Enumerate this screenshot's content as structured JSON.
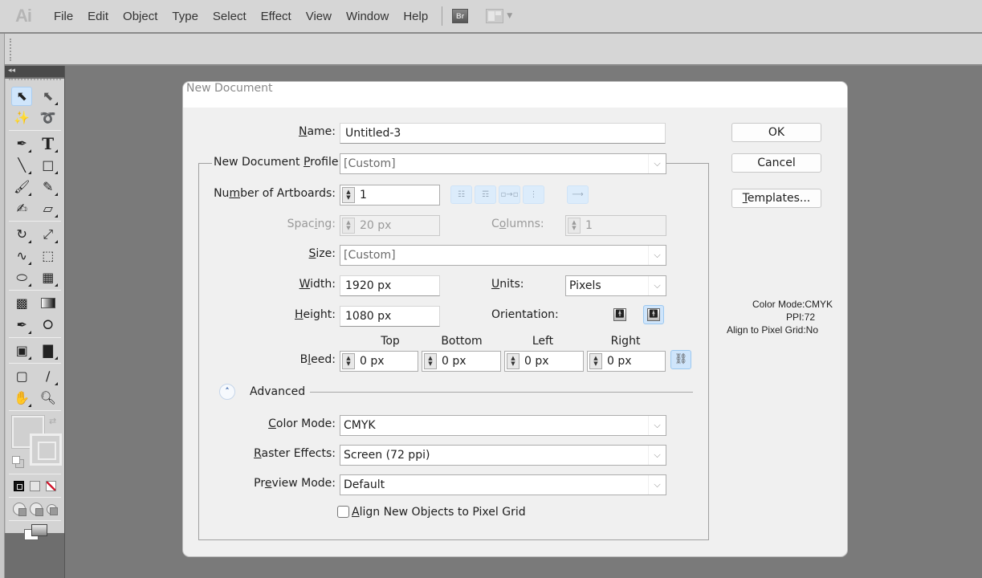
{
  "app": {
    "logo": "Ai",
    "menu": [
      "File",
      "Edit",
      "Object",
      "Type",
      "Select",
      "Effect",
      "View",
      "Window",
      "Help"
    ],
    "bridge_label": "Br",
    "tools_collapse": "◂◂"
  },
  "dialog": {
    "title": "New Document",
    "name_label": "Name:",
    "name_label_u": "N",
    "name_label_rest": "ame:",
    "name_value": "Untitled-3",
    "profile_label_pre": "New Document ",
    "profile_label_u": "P",
    "profile_label_post": "rofile:",
    "profile_value": "[Custom]",
    "artboards_label_pre": "Nu",
    "artboards_label_u": "m",
    "artboards_label_post": "ber of Artboards:",
    "artboards_value": "1",
    "artboard_layout_icons": [
      "grid-by-row-icon",
      "grid-by-column-icon",
      "arrange-by-row-icon",
      "arrange-by-column-icon",
      "left-to-right-layout-icon"
    ],
    "spacing_label_pre": "Spac",
    "spacing_label_u": "i",
    "spacing_label_post": "ng:",
    "spacing_value": "20 px",
    "columns_label_pre": "C",
    "columns_label_u": "o",
    "columns_label_post": "lumns:",
    "columns_value": "1",
    "size_label_u": "S",
    "size_label_post": "ize:",
    "size_value": "[Custom]",
    "width_label_u": "W",
    "width_label_post": "idth:",
    "width_value": "1920 px",
    "units_label_u": "U",
    "units_label_post": "nits:",
    "units_value": "Pixels",
    "height_label_u": "H",
    "height_label_post": "eight:",
    "height_value": "1080 px",
    "orientation_label": "Orientation:",
    "orientation_selected": "landscape",
    "bleed_label_pre": "B",
    "bleed_label_u": "l",
    "bleed_label_post": "eed:",
    "bleed": [
      {
        "label": "Top",
        "value": "0 px"
      },
      {
        "label": "Bottom",
        "value": "0 px"
      },
      {
        "label": "Left",
        "value": "0 px"
      },
      {
        "label": "Right",
        "value": "0 px"
      }
    ],
    "advanced_label": "Advanced",
    "color_mode_label_u": "C",
    "color_mode_label_post": "olor Mode:",
    "color_mode_value": "CMYK",
    "raster_label_u": "R",
    "raster_label_post": "aster Effects:",
    "raster_value": "Screen (72 ppi)",
    "preview_label_pre": "Pr",
    "preview_label_u": "e",
    "preview_label_post": "view Mode:",
    "preview_value": "Default",
    "align_checkbox_u": "A",
    "align_checkbox_post": "lign New Objects to Pixel Grid",
    "align_checked": false,
    "buttons": {
      "ok": "OK",
      "cancel": "Cancel",
      "templates_u": "T",
      "templates_post": "emplates..."
    },
    "summary": {
      "color_mode": "Color Mode:CMYK",
      "ppi": "PPI:72",
      "align": "Align to Pixel Grid:No"
    }
  }
}
